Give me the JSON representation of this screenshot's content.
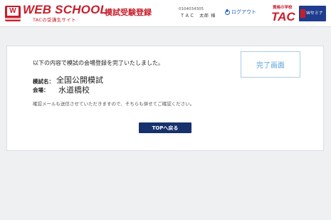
{
  "header": {
    "brand_title": "WEB SCHOOL",
    "brand_subtitle": "TACの受講生サイト",
    "page_heading": "模試受験登録",
    "user_id": "0104034305",
    "user_name": "ＴＡＣ　太郎 様",
    "logout_label": "ログアウト",
    "tac_tagline": "資格の学校",
    "tac_logo_text": "TAC",
    "seminar_logo_text": "Wセミナー"
  },
  "main": {
    "message": "以下の内容で模試の会場登録を完了いたしました。",
    "complete_label": "完了画面",
    "exam_label": "模試名：",
    "exam_value": "全国公開模試",
    "venue_label": "会場：",
    "venue_value": "水道橋校",
    "note": "確認メールも送信させていただきますので、そちらも併せてご確認ください。",
    "top_button_label": "TOPへ戻る"
  },
  "colors": {
    "brand_red": "#c81e2b",
    "navy": "#16316b",
    "complete_blue": "#5aa4dc",
    "background": "#eef0f2"
  }
}
